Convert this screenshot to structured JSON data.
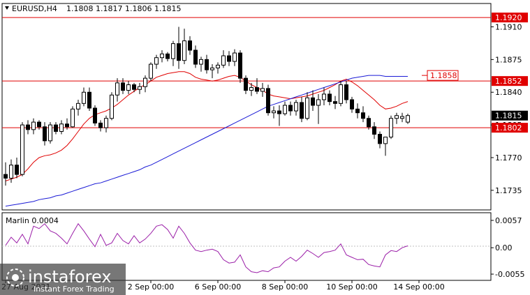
{
  "header": {
    "symbol": "EURUSD,H4",
    "ohlc": "1.1808 1.1817 1.1806 1.1815"
  },
  "indicator": {
    "label": "Marlin 0.0004",
    "color": "#9b1fa8"
  },
  "watermark": {
    "brand": "instaforex",
    "tagline": "Instant Forex Trading"
  },
  "colors": {
    "bull_candle": "#ffffff",
    "bear_candle": "#000000",
    "level_line": "#e00000",
    "ma_fast": "#e00000",
    "ma_slow": "#1a1ad6",
    "oscillator": "#9b1fa8"
  },
  "chart_data": [
    {
      "type": "candlestick",
      "title": "EURUSD,H4",
      "ylim": [
        1.1714,
        1.1935
      ],
      "y_ticks": [
        "1.1910",
        "1.1875",
        "1.1840",
        "1.1805",
        "1.1770",
        "1.1735"
      ],
      "x_ticks": [
        "27 Aug 2021",
        "2 Sep 00:00",
        "6 Sep 00:00",
        "8 Sep 00:00",
        "10 Sep 00:00",
        "14 Sep 00:00"
      ],
      "x_tick_bar_index": [
        0,
        26,
        38,
        50,
        62,
        74
      ],
      "levels": [
        {
          "value": 1.192,
          "label": "1.1920"
        },
        {
          "value": 1.1852,
          "label": "1.1852"
        },
        {
          "value": 1.1802,
          "label": "1.1802"
        }
      ],
      "price_marker": {
        "value": 1.1815,
        "label": "1.1815"
      },
      "target_marker": {
        "value": 1.1858,
        "label": "1.1858"
      },
      "ohlc": [
        [
          1.1752,
          1.1765,
          1.174,
          1.1748
        ],
        [
          1.1748,
          1.1768,
          1.1743,
          1.1762
        ],
        [
          1.1762,
          1.177,
          1.1748,
          1.1752
        ],
        [
          1.1752,
          1.1808,
          1.175,
          1.1805
        ],
        [
          1.1805,
          1.181,
          1.1795,
          1.18
        ],
        [
          1.18,
          1.1812,
          1.1795,
          1.1808
        ],
        [
          1.1808,
          1.181,
          1.18,
          1.1803
        ],
        [
          1.1803,
          1.1808,
          1.1783,
          1.1788
        ],
        [
          1.1788,
          1.1808,
          1.1785,
          1.1805
        ],
        [
          1.1805,
          1.1808,
          1.1795,
          1.1798
        ],
        [
          1.1798,
          1.181,
          1.1795,
          1.1806
        ],
        [
          1.1806,
          1.1812,
          1.18,
          1.1803
        ],
        [
          1.1803,
          1.1825,
          1.1802,
          1.1822
        ],
        [
          1.1822,
          1.1832,
          1.1815,
          1.1828
        ],
        [
          1.1828,
          1.1845,
          1.1825,
          1.184
        ],
        [
          1.184,
          1.1845,
          1.182,
          1.1823
        ],
        [
          1.1823,
          1.1826,
          1.1804,
          1.1807
        ],
        [
          1.1807,
          1.181,
          1.1798,
          1.1802
        ],
        [
          1.1802,
          1.1815,
          1.1797,
          1.1812
        ],
        [
          1.1812,
          1.184,
          1.181,
          1.1837
        ],
        [
          1.1837,
          1.1855,
          1.183,
          1.185
        ],
        [
          1.185,
          1.1855,
          1.1838,
          1.1842
        ],
        [
          1.1842,
          1.1852,
          1.1838,
          1.1848
        ],
        [
          1.1848,
          1.185,
          1.184,
          1.1843
        ],
        [
          1.1843,
          1.185,
          1.1838,
          1.1846
        ],
        [
          1.1846,
          1.1858,
          1.184,
          1.1855
        ],
        [
          1.1855,
          1.1872,
          1.1852,
          1.187
        ],
        [
          1.187,
          1.188,
          1.1865,
          1.1877
        ],
        [
          1.1877,
          1.1885,
          1.1872,
          1.1881
        ],
        [
          1.1881,
          1.1883,
          1.1873,
          1.1876
        ],
        [
          1.1876,
          1.1895,
          1.1868,
          1.1892
        ],
        [
          1.1892,
          1.191,
          1.1865,
          1.1874
        ],
        [
          1.1874,
          1.1908,
          1.187,
          1.1895
        ],
        [
          1.1895,
          1.19,
          1.188,
          1.1885
        ],
        [
          1.1885,
          1.189,
          1.1866,
          1.187
        ],
        [
          1.187,
          1.1878,
          1.1862,
          1.1875
        ],
        [
          1.1875,
          1.188,
          1.186,
          1.1864
        ],
        [
          1.1864,
          1.187,
          1.1855,
          1.1866
        ],
        [
          1.1866,
          1.1872,
          1.186,
          1.1869
        ],
        [
          1.1869,
          1.1885,
          1.1866,
          1.1879
        ],
        [
          1.1879,
          1.1884,
          1.1868,
          1.1873
        ],
        [
          1.1873,
          1.1886,
          1.1868,
          1.1882
        ],
        [
          1.1882,
          1.1885,
          1.185,
          1.1855
        ],
        [
          1.1855,
          1.1858,
          1.1838,
          1.1842
        ],
        [
          1.1842,
          1.185,
          1.1836,
          1.1845
        ],
        [
          1.1845,
          1.1855,
          1.1838,
          1.1841
        ],
        [
          1.1841,
          1.185,
          1.1835,
          1.1844
        ],
        [
          1.1844,
          1.1848,
          1.1815,
          1.1818
        ],
        [
          1.1818,
          1.1825,
          1.1812,
          1.182
        ],
        [
          1.182,
          1.1826,
          1.1804,
          1.1817
        ],
        [
          1.1817,
          1.183,
          1.1815,
          1.1826
        ],
        [
          1.1826,
          1.183,
          1.1815,
          1.182
        ],
        [
          1.182,
          1.1832,
          1.1815,
          1.1829
        ],
        [
          1.1829,
          1.1835,
          1.1808,
          1.1812
        ],
        [
          1.1812,
          1.184,
          1.181,
          1.1834
        ],
        [
          1.1834,
          1.1842,
          1.182,
          1.1826
        ],
        [
          1.1826,
          1.1838,
          1.1806,
          1.1832
        ],
        [
          1.1832,
          1.1845,
          1.1826,
          1.1838
        ],
        [
          1.1838,
          1.1842,
          1.1826,
          1.183
        ],
        [
          1.183,
          1.1836,
          1.1822,
          1.1828
        ],
        [
          1.1828,
          1.1852,
          1.1825,
          1.1848
        ],
        [
          1.1848,
          1.1852,
          1.1828,
          1.1832
        ],
        [
          1.1832,
          1.1835,
          1.1818,
          1.1822
        ],
        [
          1.1822,
          1.1828,
          1.1812,
          1.1818
        ],
        [
          1.1818,
          1.1825,
          1.1808,
          1.1812
        ],
        [
          1.1812,
          1.1815,
          1.18,
          1.1803
        ],
        [
          1.1803,
          1.1808,
          1.179,
          1.1795
        ],
        [
          1.1795,
          1.1798,
          1.178,
          1.1785
        ],
        [
          1.1785,
          1.179,
          1.1772,
          1.1792
        ],
        [
          1.1792,
          1.1815,
          1.179,
          1.1812
        ],
        [
          1.1812,
          1.1818,
          1.1806,
          1.1815
        ],
        [
          1.1812,
          1.1818,
          1.1808,
          1.1814
        ],
        [
          1.1808,
          1.1817,
          1.1806,
          1.1815
        ]
      ],
      "series": [
        {
          "values": [
            1.1745,
            1.1747,
            1.1749,
            1.1752,
            1.1758,
            1.1765,
            1.177,
            1.1772,
            1.1773,
            1.1775,
            1.1778,
            1.1783,
            1.179,
            1.1798,
            1.1806,
            1.1812,
            1.1816,
            1.1818,
            1.182,
            1.1823,
            1.1827,
            1.1832,
            1.1837,
            1.1841,
            1.1845,
            1.1848,
            1.1852,
            1.1856,
            1.1858,
            1.186,
            1.1861,
            1.1862,
            1.1862,
            1.186,
            1.1856,
            1.1854,
            1.1853,
            1.1852,
            1.1853,
            1.1855,
            1.1857,
            1.1858,
            1.1856,
            1.1852,
            1.1848,
            1.1845,
            1.1842,
            1.1838,
            1.1836,
            1.1835,
            1.1834,
            1.1833,
            1.1834,
            1.1835,
            1.1836,
            1.1838,
            1.184,
            1.1842,
            1.1845,
            1.1848,
            1.1852,
            1.1854,
            1.1851,
            1.1847,
            1.1842,
            1.1837,
            1.1832,
            1.1826,
            1.1822,
            1.1823,
            1.1825,
            1.1828,
            1.183
          ]
        },
        {
          "values": [
            1.1718,
            1.1719,
            1.172,
            1.1721,
            1.1722,
            1.1723,
            1.1725,
            1.1726,
            1.1727,
            1.1729,
            1.173,
            1.1732,
            1.1734,
            1.1736,
            1.1738,
            1.174,
            1.1742,
            1.1743,
            1.1745,
            1.1747,
            1.1749,
            1.1751,
            1.1753,
            1.1755,
            1.1757,
            1.176,
            1.1762,
            1.1765,
            1.1768,
            1.1771,
            1.1774,
            1.1777,
            1.178,
            1.1783,
            1.1786,
            1.1789,
            1.1792,
            1.1795,
            1.1798,
            1.1801,
            1.1804,
            1.1807,
            1.181,
            1.1813,
            1.1816,
            1.1819,
            1.1822,
            1.1825,
            1.1827,
            1.1829,
            1.1831,
            1.1833,
            1.1835,
            1.1837,
            1.1839,
            1.1841,
            1.1843,
            1.1845,
            1.1847,
            1.1849,
            1.1851,
            1.1853,
            1.1855,
            1.1856,
            1.1857,
            1.1858,
            1.1858,
            1.1858,
            1.1857,
            1.1857,
            1.1857,
            1.1857,
            1.1857
          ]
        }
      ]
    },
    {
      "type": "line",
      "title": "Marlin 0.0004",
      "ylim": [
        -0.0068,
        0.0073
      ],
      "y_ticks": [
        "0.0057",
        "0.00",
        "-0.0055"
      ],
      "series": [
        {
          "name": "Marlin",
          "values": [
            0.0005,
            0.0022,
            0.001,
            0.0028,
            0.0008,
            0.0045,
            0.004,
            0.005,
            0.0035,
            0.003,
            0.002,
            0.0008,
            0.003,
            0.005,
            0.0035,
            0.0018,
            0.0002,
            0.0028,
            0.0005,
            0.001,
            0.003,
            0.0015,
            0.0008,
            0.0025,
            0.001,
            0.0018,
            0.003,
            0.0045,
            0.0048,
            0.0038,
            0.002,
            0.0045,
            0.003,
            0.001,
            -0.0005,
            -0.0008,
            -0.0005,
            -0.0003,
            -0.0008,
            -0.0025,
            -0.0032,
            -0.003,
            -0.0015,
            -0.004,
            -0.005,
            -0.0052,
            -0.0048,
            -0.005,
            -0.0042,
            -0.004,
            -0.0028,
            -0.002,
            -0.0028,
            -0.0018,
            -0.0005,
            -0.0012,
            -0.002,
            -0.001,
            -0.0008,
            -0.0005,
            0.0008,
            -0.0015,
            -0.002,
            -0.0025,
            -0.0024,
            -0.0035,
            -0.0038,
            -0.004,
            -0.0015,
            -0.0006,
            -0.0008,
            0.0,
            0.0004
          ]
        }
      ]
    }
  ]
}
